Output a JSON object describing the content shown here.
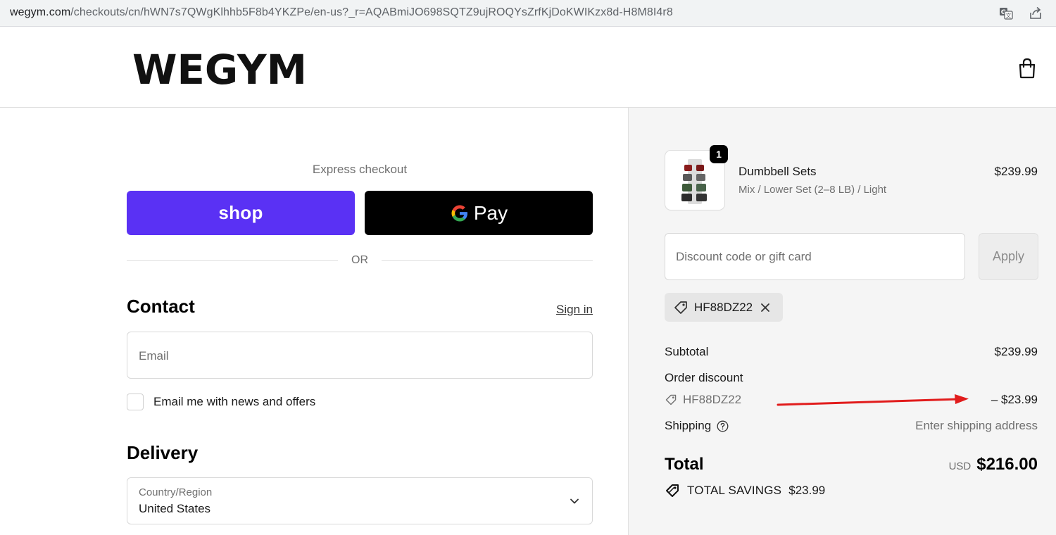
{
  "browser": {
    "url_host": "wegym.com",
    "url_path": "/checkouts/cn/hWN7s7QWgKlhhb5F8b4YKZPe/en-us?_r=AQABmiJO698SQTZ9ujROQYsZrfKjDoKWIKzx8d-H8M8I4r8"
  },
  "header": {
    "logo_text": "WEGYM"
  },
  "express": {
    "title": "Express checkout",
    "shop_label": "shop",
    "gpay_label": "Pay",
    "or_text": "OR"
  },
  "contact": {
    "title": "Contact",
    "signin_label": "Sign in",
    "email_placeholder": "Email",
    "newsletter_label": "Email me with news and offers"
  },
  "delivery": {
    "title": "Delivery",
    "country_label": "Country/Region",
    "country_value": "United States"
  },
  "order": {
    "item": {
      "quantity": "1",
      "name": "Dumbbell Sets",
      "variant": "Mix / Lower Set (2–8 LB) / Light",
      "price": "$239.99"
    },
    "discount_placeholder": "Discount code or gift card",
    "apply_label": "Apply",
    "applied_code": "HF88DZ22",
    "subtotal_label": "Subtotal",
    "subtotal_value": "$239.99",
    "order_discount_label": "Order discount",
    "order_discount_code": "HF88DZ22",
    "order_discount_value": "– $23.99",
    "shipping_label": "Shipping",
    "shipping_value": "Enter shipping address",
    "total_label": "Total",
    "total_currency": "USD",
    "total_value": "$216.00",
    "savings_label": "TOTAL SAVINGS",
    "savings_value": "$23.99"
  },
  "colors": {
    "shop_pay": "#5a31f4",
    "gpay": "#000000",
    "annotation_arrow": "#e11c1c",
    "summary_bg": "#f5f5f5"
  }
}
